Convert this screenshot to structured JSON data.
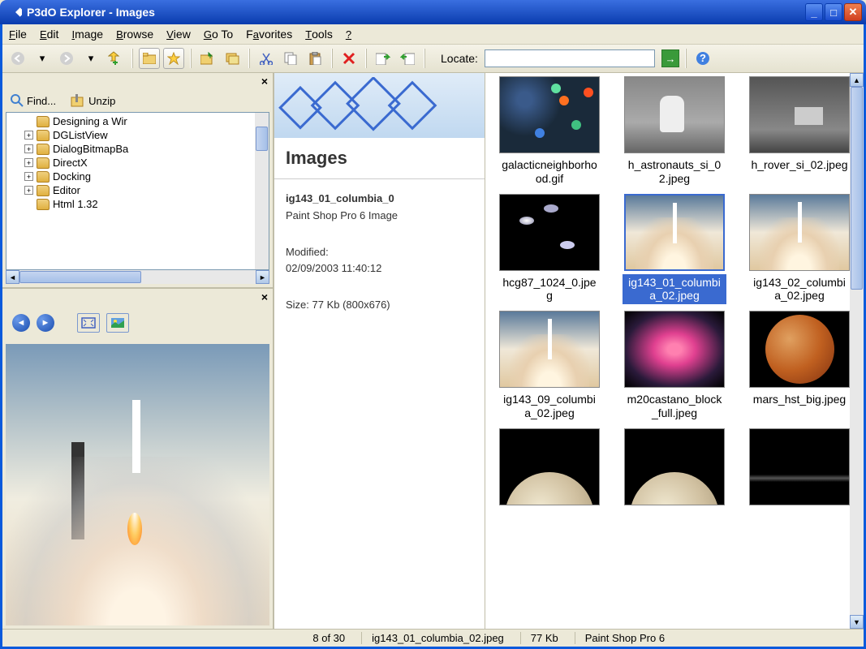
{
  "window": {
    "title": "P3dO Explorer - Images"
  },
  "menu": [
    "File",
    "Edit",
    "Image",
    "Browse",
    "View",
    "Go To",
    "Favorites",
    "Tools",
    "?"
  ],
  "toolbar": {
    "locate_label": "Locate:"
  },
  "tree_panel": {
    "find_label": "Find...",
    "unzip_label": "Unzip",
    "items": [
      {
        "label": "Designing a Wir",
        "expand": null
      },
      {
        "label": "DGListView",
        "expand": "+"
      },
      {
        "label": "DialogBitmapBa",
        "expand": "+"
      },
      {
        "label": "DirectX",
        "expand": "+"
      },
      {
        "label": "Docking",
        "expand": "+"
      },
      {
        "label": "Editor",
        "expand": "+"
      },
      {
        "label": "Html 1.32",
        "expand": null
      }
    ]
  },
  "info": {
    "section_title": "Images",
    "filename": "ig143_01_columbia_0",
    "filetype": "Paint Shop Pro 6 Image",
    "modified_label": "Modified:",
    "modified_value": "02/09/2003 11:40:12",
    "size_line": "Size: 77 Kb  (800x676)"
  },
  "thumbnails": [
    {
      "label": "galacticneighborhood.gif",
      "art": "art-galactic"
    },
    {
      "label": "h_astronauts_si_02.jpeg",
      "art": "art-astronaut"
    },
    {
      "label": "h_rover_si_02.jpeg",
      "art": "art-rover"
    },
    {
      "label": "hcg87_1024_0.jpeg",
      "art": "art-galaxies"
    },
    {
      "label": "ig143_01_columbia_02.jpeg",
      "art": "art-shuttle",
      "selected": true
    },
    {
      "label": "ig143_02_columbia_02.jpeg",
      "art": "art-shuttle"
    },
    {
      "label": "ig143_09_columbia_02.jpeg",
      "art": "art-shuttle"
    },
    {
      "label": "m20castano_block_full.jpeg",
      "art": "art-nebula"
    },
    {
      "label": "mars_hst_big.jpeg",
      "art": "art-mars"
    },
    {
      "label": "",
      "art": "art-moon"
    },
    {
      "label": "",
      "art": "art-moon"
    },
    {
      "label": "",
      "art": "art-dark"
    }
  ],
  "status": {
    "count": "8 of 30",
    "filename": "ig143_01_columbia_02.jpeg",
    "size": "77 Kb",
    "type": "Paint Shop Pro 6"
  }
}
